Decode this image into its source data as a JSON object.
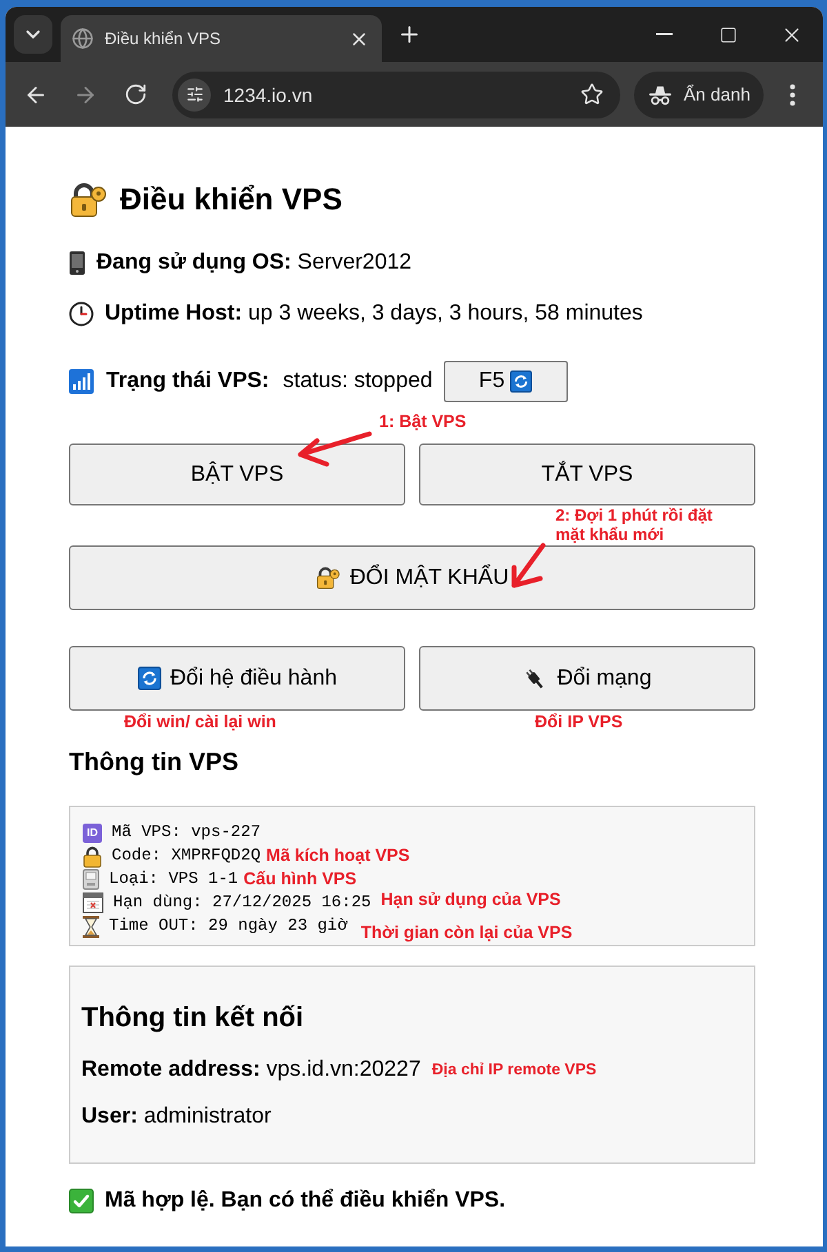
{
  "browser": {
    "tabs": [
      {
        "title": "Điều khiển VPS",
        "selected": true
      }
    ],
    "url": "1234.io.vn",
    "profile_chip": "Ẩn danh",
    "back_disabled": false,
    "forward_disabled": true
  },
  "title": "Điều khiển VPS",
  "os_line": "**Đang sử dụng OS:** Server2012",
  "uptime_line": "**Uptime Host:** up 3 weeks, 3 days, 3 hours, 58 minutes",
  "status": {
    "label": "Trạng thái VPS:",
    "value": "status: stopped",
    "refresh_button": "F5"
  },
  "power_buttons": [
    {
      "label": "BẬT VPS",
      "note": "1: Bật VPS"
    },
    {
      "label": "TẮT VPS"
    }
  ],
  "password_button": {
    "label": "ĐỔI MẬT KHẨU",
    "note": "2: Đợi 1 phút rồi đặt\nmặt khẩu mới"
  },
  "system_buttons": [
    {
      "kind": "os",
      "label": "Đổi hệ điều hành",
      "note": "Đổi win/ cài lại win"
    },
    {
      "kind": "network",
      "label": "Đổi mạng",
      "note": "Đổi IP VPS"
    }
  ],
  "vps_info": {
    "heading": "Thông tin VPS",
    "lines": [
      {
        "kind": "id",
        "badge": "ID",
        "text": "Mã VPS: vps-227"
      },
      {
        "kind": "code",
        "text": "Code: XMPRFQD2Q",
        "note": "Mã kích hoạt VPS"
      },
      {
        "kind": "plan",
        "text": "Loại: VPS 1-1",
        "note": "Cấu hình VPS"
      },
      {
        "kind": "expiry",
        "text": "Hạn dùng: 27/12/2025 16:25",
        "note": "Hạn sử dụng của VPS"
      },
      {
        "kind": "timeout",
        "text": "Time OUT: 29 ngày 23 giờ",
        "note": "Thời gian còn lại của VPS"
      }
    ]
  },
  "connection": {
    "heading": "Thông tin kết nối",
    "remote": "**Remote address:** vps.id.vn:20227",
    "remote_note": "Địa chỉ IP remote VPS",
    "user": "**User:** administrator"
  },
  "validation_message": "Mã hợp lệ. Bạn có thể điều khiển VPS."
}
